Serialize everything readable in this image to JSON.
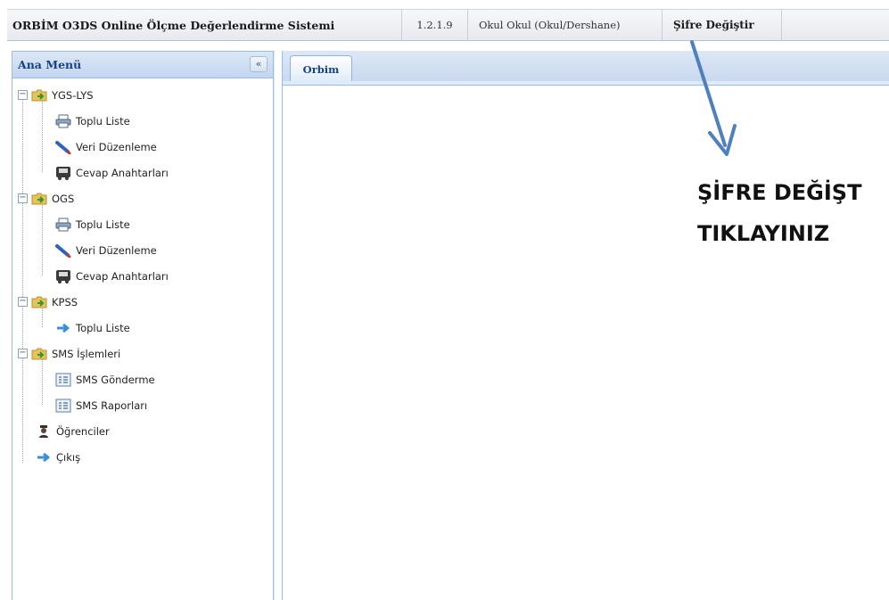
{
  "topbar": {
    "app_title": "ORBİM O3DS Online Ölçme Değerlendirme Sistemi",
    "version": "1.2.1.9",
    "organization": "Okul Okul (Okul/Dershane)",
    "change_password": "Şifre Değiştir"
  },
  "sidebar": {
    "title": "Ana Menü",
    "collapse_icon": "double-chevron-left-icon",
    "groups": [
      {
        "label": "YGS-LYS",
        "icon": "folder-arrow-icon",
        "items": [
          {
            "label": "Toplu Liste",
            "icon": "printer-icon"
          },
          {
            "label": "Veri Düzenleme",
            "icon": "pencil-icon"
          },
          {
            "label": "Cevap Anahtarları",
            "icon": "answer-key-icon"
          }
        ]
      },
      {
        "label": "OGS",
        "icon": "folder-arrow-icon",
        "items": [
          {
            "label": "Toplu Liste",
            "icon": "printer-icon"
          },
          {
            "label": "Veri Düzenleme",
            "icon": "pencil-icon"
          },
          {
            "label": "Cevap Anahtarları",
            "icon": "answer-key-icon"
          }
        ]
      },
      {
        "label": "KPSS",
        "icon": "folder-arrow-icon",
        "items": [
          {
            "label": "Toplu Liste",
            "icon": "arrow-right-icon"
          }
        ]
      },
      {
        "label": "SMS İşlemleri",
        "icon": "folder-arrow-icon",
        "items": [
          {
            "label": "SMS Gönderme",
            "icon": "list-icon"
          },
          {
            "label": "SMS Raporları",
            "icon": "list-icon"
          }
        ]
      }
    ],
    "root_items": [
      {
        "label": "Öğrenciler",
        "icon": "student-icon"
      },
      {
        "label": "Çıkış",
        "icon": "arrow-right-icon"
      }
    ]
  },
  "main": {
    "tabs": [
      {
        "label": "Orbim",
        "active": true
      }
    ]
  },
  "annotation": {
    "line1": "ŞİFRE DEĞİŞT",
    "line2": "TIKLAYINIZ",
    "arrow_color": "#4f7fbe"
  }
}
